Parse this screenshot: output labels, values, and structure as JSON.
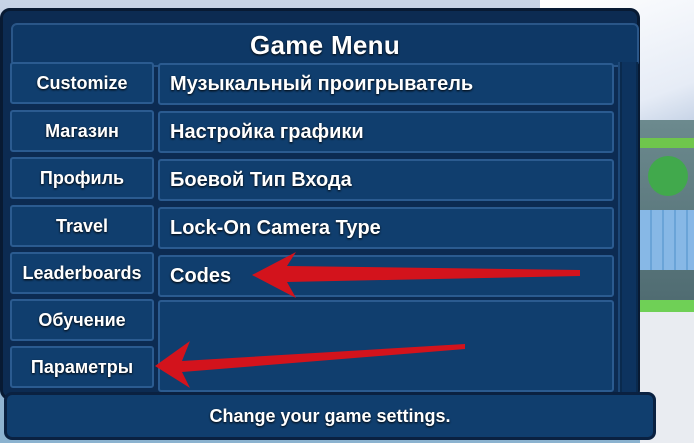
{
  "menu": {
    "title": "Game Menu",
    "tabs": [
      {
        "label": "Customize"
      },
      {
        "label": "Магазин"
      },
      {
        "label": "Профиль"
      },
      {
        "label": "Travel"
      },
      {
        "label": "Leaderboards"
      },
      {
        "label": "Обучение"
      },
      {
        "label": "Параметры"
      }
    ],
    "options": [
      {
        "label": "Музыкальный проигрыватель"
      },
      {
        "label": "Настройка графики"
      },
      {
        "label": "Боевой Тип Входа"
      },
      {
        "label": "Lock-On Camera Type"
      },
      {
        "label": "Codes"
      }
    ],
    "status_text": "Change your game settings."
  },
  "annotations": {
    "arrow_color": "#d3131c",
    "arrow_targets": [
      "Codes",
      "Параметры"
    ]
  },
  "colors": {
    "panel": "#0c2b52",
    "button": "#103e6e",
    "button_border": "#2b5b90",
    "text": "#ffffff"
  }
}
